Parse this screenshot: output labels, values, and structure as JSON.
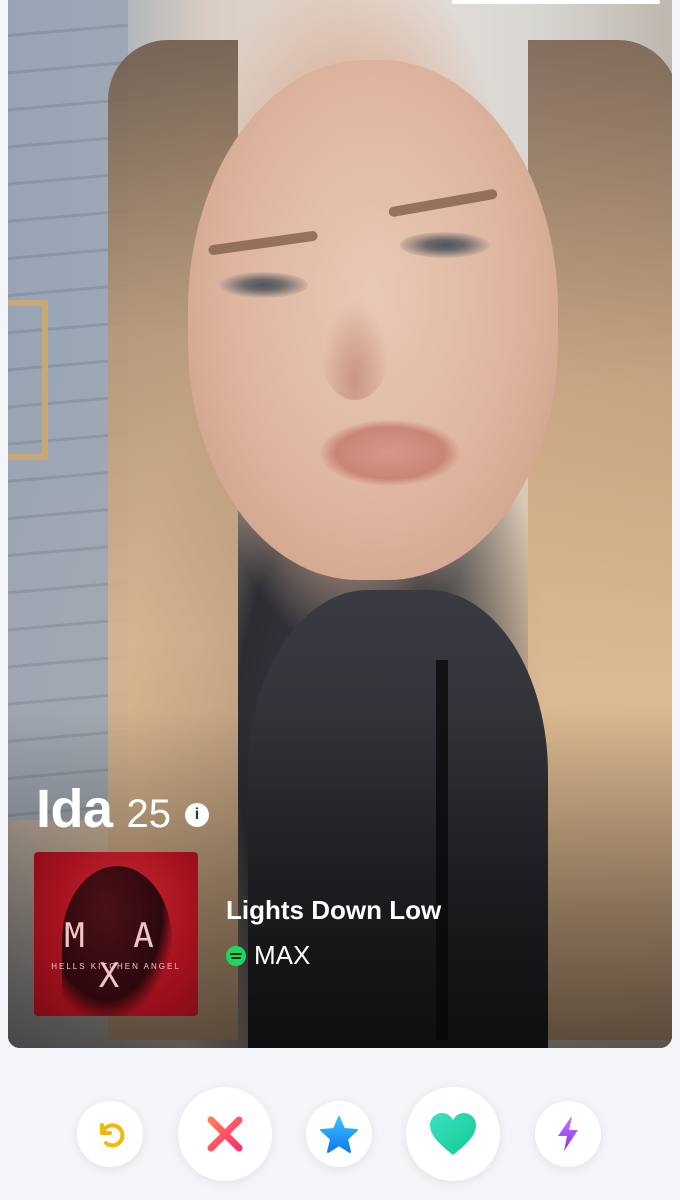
{
  "profile": {
    "name": "Ida",
    "age": "25",
    "info_icon": "info-icon"
  },
  "anthem": {
    "album_art_title": "M A X",
    "album_art_subtitle": "HELLS KITCHEN ANGEL",
    "song_title": "Lights Down Low",
    "artist": "MAX",
    "service_icon": "spotify-icon"
  },
  "actions": [
    {
      "name": "rewind",
      "icon": "rewind-icon",
      "color": "#f5b700"
    },
    {
      "name": "nope",
      "icon": "close-icon",
      "color": "#ff4458"
    },
    {
      "name": "super-like",
      "icon": "star-icon",
      "color": "#1e9bf0"
    },
    {
      "name": "like",
      "icon": "heart-icon",
      "color": "#21d8a3"
    },
    {
      "name": "boost",
      "icon": "lightning-icon",
      "color": "#a64bf4"
    }
  ],
  "colors": {
    "background": "#f4f5f8"
  }
}
